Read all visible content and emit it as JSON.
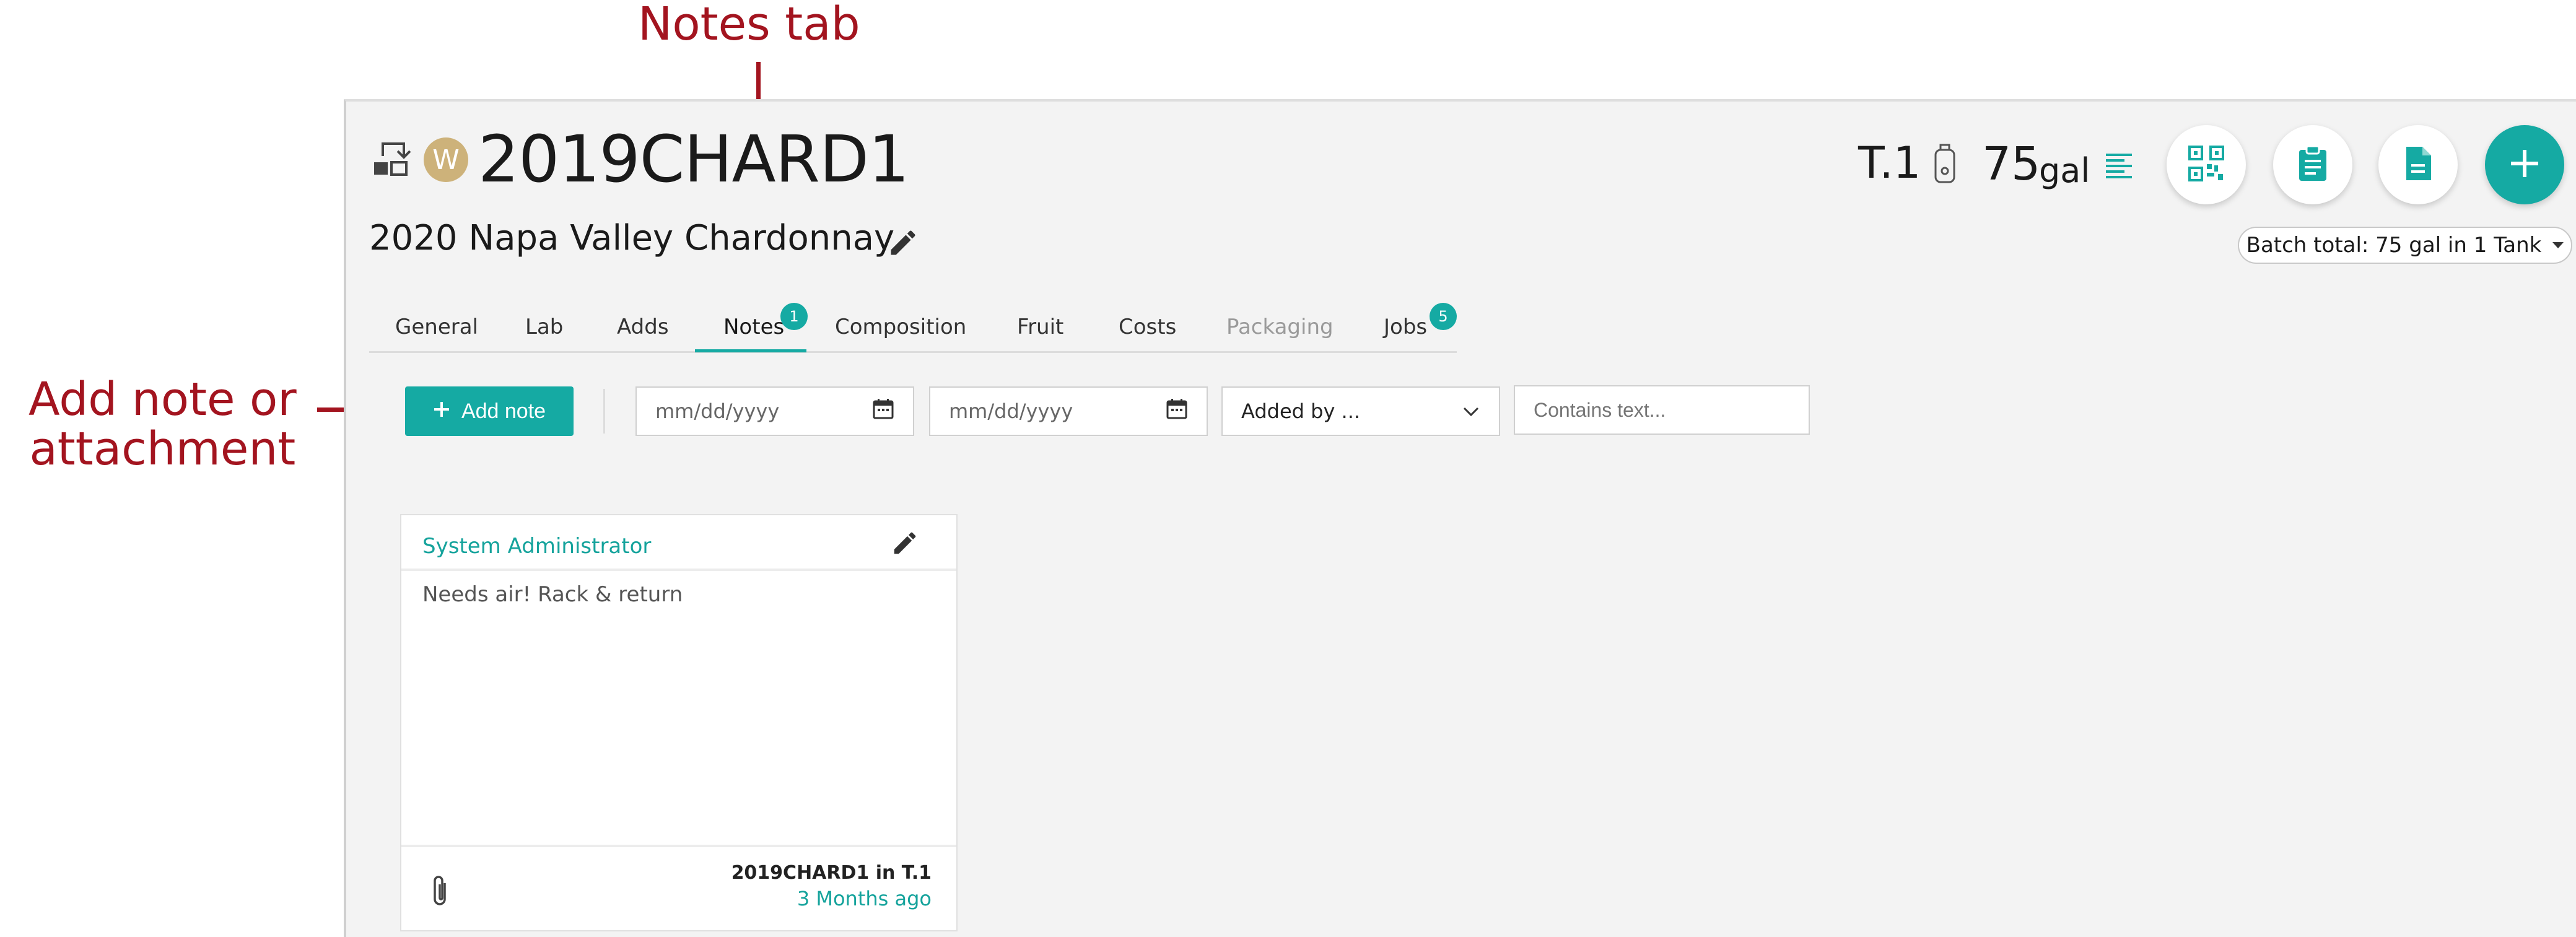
{
  "annotations": {
    "notes_tab": "Notes tab",
    "add_note_line1": "Add note or",
    "add_note_line2": "attachment"
  },
  "header": {
    "avatar_letter": "W",
    "lot_code": "2019CHARD1",
    "lot_name": "2020 Napa Valley Chardonnay",
    "tank": "T.1",
    "volume": "75",
    "volume_unit": "gal",
    "batch_total": "Batch total: 75 gal in 1 Tank"
  },
  "tabs": [
    {
      "label": "General"
    },
    {
      "label": "Lab"
    },
    {
      "label": "Adds"
    },
    {
      "label": "Notes",
      "badge": "1",
      "active": true
    },
    {
      "label": "Composition"
    },
    {
      "label": "Fruit"
    },
    {
      "label": "Costs"
    },
    {
      "label": "Packaging",
      "disabled": true
    },
    {
      "label": "Jobs",
      "badge": "5"
    }
  ],
  "toolbar": {
    "add_note_label": "Add note",
    "date_from_placeholder": "mm/dd/yyyy",
    "date_to_placeholder": "mm/dd/yyyy",
    "added_by_label": "Added by ...",
    "contains_text_placeholder": "Contains text..."
  },
  "note": {
    "author": "System Administrator",
    "body": "Needs air! Rack & return",
    "location": "2019CHARD1 in T.1",
    "time": "3 Months ago"
  },
  "colors": {
    "accent": "#15aaa3",
    "annotation": "#a3141f",
    "avatar": "#cdb27a"
  },
  "icons": {
    "swap": "swap-icon",
    "edit": "pencil-icon",
    "tank": "tank-icon",
    "details": "align-left-icon",
    "qr": "qr-code-icon",
    "clipboard": "clipboard-icon",
    "document": "document-icon",
    "add": "plus-icon",
    "calendar": "calendar-icon",
    "chevron": "chevron-down-icon",
    "attachment": "paperclip-icon"
  }
}
